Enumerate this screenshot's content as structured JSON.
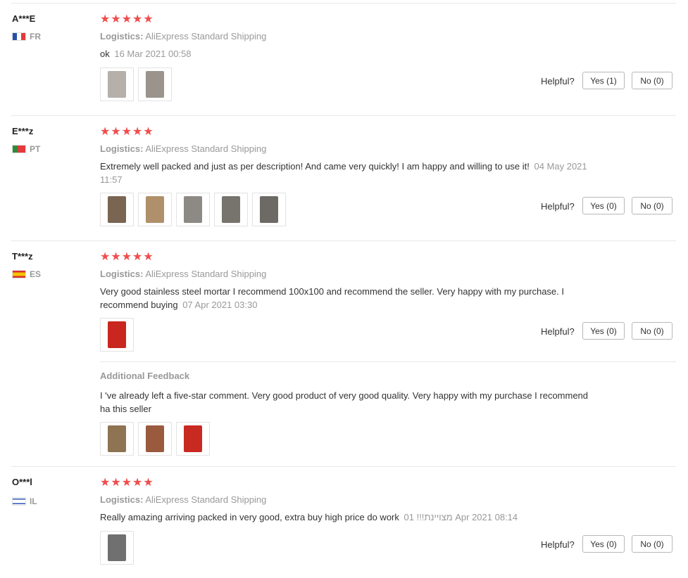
{
  "reviews": [
    {
      "user": "A***E",
      "country": "FR",
      "flag": "france",
      "stars": "★★★★★",
      "logistics_label": "Logistics:",
      "logistics_value": "AliExpress Standard Shipping",
      "text": "ok",
      "date": "16 Mar 2021 00:58",
      "photos": [
        "#b5b0aa",
        "#9a948c"
      ],
      "helpful_label": "Helpful?",
      "yes_label": "Yes (1)",
      "no_label": "No (0)"
    },
    {
      "user": "E***z",
      "country": "PT",
      "flag": "portugal",
      "stars": "★★★★★",
      "logistics_label": "Logistics:",
      "logistics_value": "AliExpress Standard Shipping",
      "text": "Extremely well packed and just as per description! And came very quickly! I am happy and willing to use it!",
      "date": "04 May 2021 11:57",
      "photos": [
        "#7a6552",
        "#b0906a",
        "#8d8a85",
        "#77736d",
        "#6d6a66"
      ],
      "helpful_label": "Helpful?",
      "yes_label": "Yes (0)",
      "no_label": "No (0)"
    },
    {
      "user": "T***z",
      "country": "ES",
      "flag": "spain",
      "stars": "★★★★★",
      "logistics_label": "Logistics:",
      "logistics_value": "AliExpress Standard Shipping",
      "text": "Very good stainless steel mortar I recommend 100x100 and recommend the seller. Very happy with my purchase. I recommend buying",
      "date": "07 Apr 2021 03:30",
      "photos": [
        "#c8261f"
      ],
      "helpful_label": "Helpful?",
      "yes_label": "Yes (0)",
      "no_label": "No (0)",
      "additional_label": "Additional Feedback",
      "additional_text": "I 've already left a five-star comment. Very good product of very good quality. Very happy with my purchase I recommend ha this seller",
      "additional_photos": [
        "#8e7452",
        "#9a5a3e",
        "#c82a22"
      ]
    },
    {
      "user": "O***l",
      "country": "IL",
      "flag": "israel",
      "stars": "★★★★★",
      "logistics_label": "Logistics:",
      "logistics_value": "AliExpress Standard Shipping",
      "text": "Really amazing arriving packed in very good, extra buy high price do work",
      "date": "01 !!!מצויינת Apr 2021 08:14",
      "photos": [
        "#707070"
      ],
      "helpful_label": "Helpful?",
      "yes_label": "Yes (0)",
      "no_label": "No (0)"
    }
  ],
  "colors": {
    "star": "#f04d4d",
    "muted_text": "#999999",
    "body_text": "#333333",
    "divider": "#e8e8e8"
  }
}
